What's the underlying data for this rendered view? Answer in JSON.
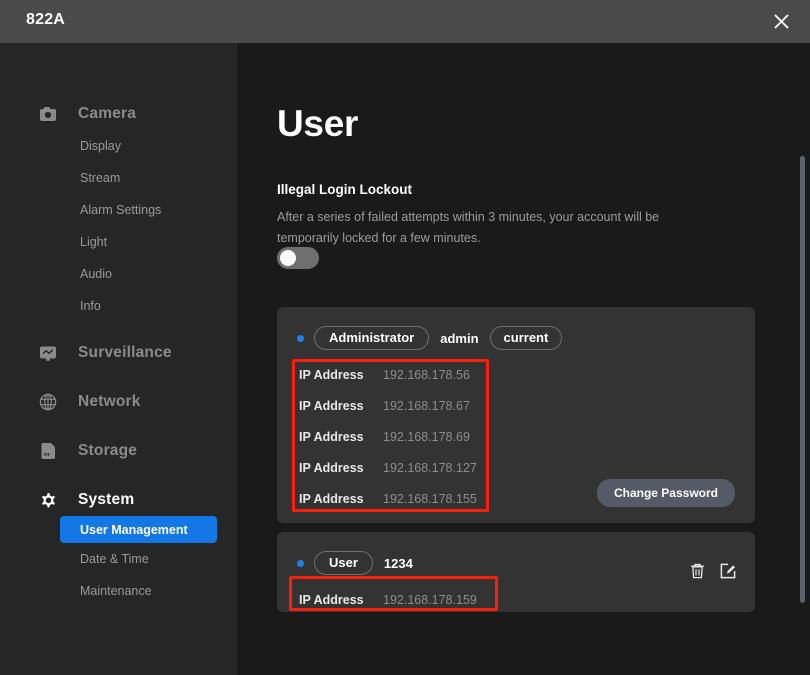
{
  "window": {
    "title": "822A",
    "close_icon": "close-icon"
  },
  "sidebar": {
    "groups": [
      {
        "label": "Camera",
        "icon": "camera-icon",
        "active": false,
        "items": [
          {
            "label": "Display",
            "selected": false
          },
          {
            "label": "Stream",
            "selected": false
          },
          {
            "label": "Alarm Settings",
            "selected": false
          },
          {
            "label": "Light",
            "selected": false
          },
          {
            "label": "Audio",
            "selected": false
          },
          {
            "label": "Info",
            "selected": false
          }
        ]
      },
      {
        "label": "Surveillance",
        "icon": "monitor-icon",
        "active": false,
        "items": []
      },
      {
        "label": "Network",
        "icon": "globe-icon",
        "active": false,
        "items": []
      },
      {
        "label": "Storage",
        "icon": "sdcard-icon",
        "active": false,
        "items": []
      },
      {
        "label": "System",
        "icon": "gear-icon",
        "active": true,
        "items": [
          {
            "label": "User Management",
            "selected": true
          },
          {
            "label": "Date & Time",
            "selected": false
          },
          {
            "label": "Maintenance",
            "selected": false
          }
        ]
      }
    ]
  },
  "main": {
    "page_title": "User",
    "lockout": {
      "title": "Illegal Login Lockout",
      "description": "After a series of failed attempts within 3 minutes, your account will be temporarily locked for a few minutes.",
      "toggle_state": "off"
    },
    "accounts": [
      {
        "role": "Administrator",
        "username": "admin",
        "tag": "current",
        "status_color": "#1a7ff0",
        "ip_label": "IP Address",
        "ips": [
          "192.168.178.56",
          "192.168.178.67",
          "192.168.178.69",
          "192.168.178.127",
          "192.168.178.155"
        ],
        "change_password_label": "Change Password"
      },
      {
        "role": "User",
        "username": "1234",
        "tag": "",
        "status_color": "#1a7ff0",
        "ip_label": "IP Address",
        "ips": [
          "192.168.178.159"
        ],
        "delete_icon": "trash-icon",
        "edit_icon": "edit-icon"
      }
    ]
  },
  "annotations": {
    "color": "#ff1d0d",
    "boxes": [
      {
        "target": "admin-ip-list"
      },
      {
        "target": "user-ip-list"
      }
    ]
  },
  "theme": {
    "titlebar_bg": "#4a4a4a",
    "sidebar_bg": "#262626",
    "content_bg": "#1a1a1a",
    "card_bg": "#333333",
    "accent": "#1477e6",
    "button_bg": "#545b66"
  }
}
